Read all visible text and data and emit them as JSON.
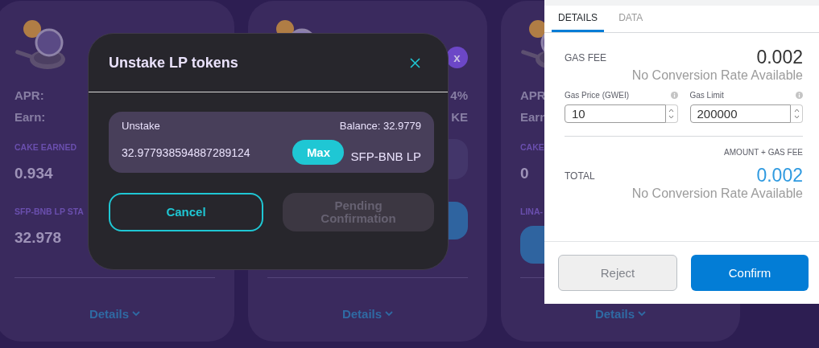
{
  "farms": [
    {
      "logo": {
        "kind": "sfp"
      },
      "items": [
        {
          "kind": "stat",
          "label": "APR:"
        },
        {
          "kind": "stat",
          "label": "Earn:"
        },
        {
          "kind": "caption",
          "text": "CAKE EARNED"
        },
        {
          "kind": "amount",
          "text": "0.934"
        },
        {
          "kind": "caption",
          "text": "SFP-BNB LP STA"
        },
        {
          "kind": "amount",
          "text": "32.978"
        }
      ],
      "details": "Details"
    },
    {
      "logo": {
        "kind": "eth"
      },
      "multiplier": "x",
      "items": [
        {
          "kind": "stat",
          "value": "4%"
        },
        {
          "kind": "stat",
          "value": "KE"
        },
        {
          "kind": "harvest"
        },
        {
          "kind": "spacer"
        },
        {
          "kind": "action"
        }
      ],
      "details": "Details"
    },
    {
      "logo": {
        "kind": "lina"
      },
      "items": [
        {
          "kind": "stat",
          "label": "APR"
        },
        {
          "kind": "stat",
          "label": "Earn"
        },
        {
          "kind": "caption",
          "text": "CAKE"
        },
        {
          "kind": "amount",
          "text": "0"
        },
        {
          "kind": "caption",
          "text": "LINA-"
        },
        {
          "kind": "action"
        }
      ],
      "details": "Details"
    }
  ],
  "modal": {
    "title": "Unstake LP tokens",
    "input_label": "Unstake",
    "balance": "Balance: 32.9779",
    "value": "32.977938594887289124",
    "max": "Max",
    "token": "SFP-BNB LP",
    "buttons": [
      {
        "label": "Cancel",
        "disabled": false
      },
      {
        "label": "Pending Confirmation",
        "disabled": true
      }
    ]
  },
  "wallet": {
    "tabs": [
      {
        "label": "DETAILS",
        "selected": true
      },
      {
        "label": "DATA",
        "selected": false
      }
    ],
    "gas_fee_label": "GAS FEE",
    "gas_fee": "0.002",
    "gas_fee_note": "No Conversion Rate Available",
    "fields": [
      {
        "label": "Gas Price (GWEI)",
        "value": "10"
      },
      {
        "label": "Gas Limit",
        "value": "200000"
      }
    ],
    "total_caption": "AMOUNT + GAS FEE",
    "total_label": "TOTAL",
    "total": "0.002",
    "total_note": "No Conversion Rate Available",
    "buttons": [
      {
        "label": "Reject",
        "primary": false
      },
      {
        "label": "Confirm",
        "primary": true
      }
    ]
  }
}
